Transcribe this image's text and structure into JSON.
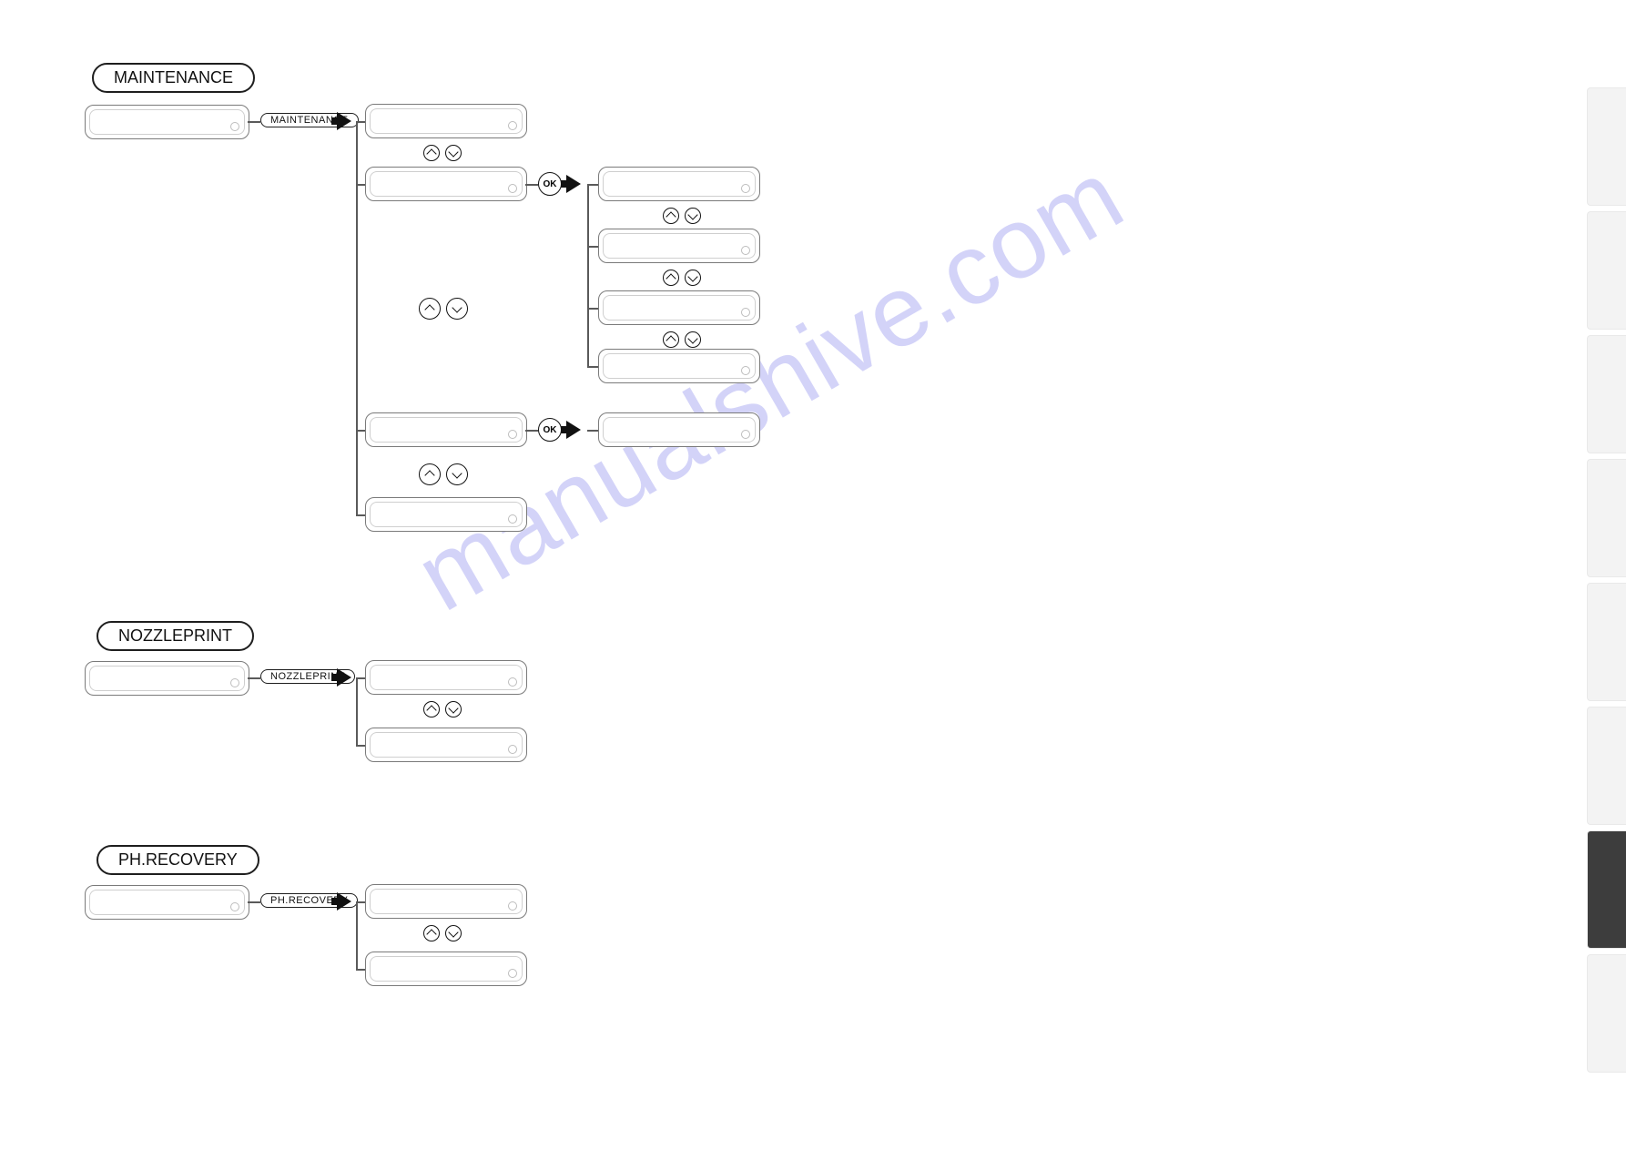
{
  "watermark": "manualshive.com",
  "sections": {
    "maintenance": {
      "heading": "MAINTENANCE",
      "capsule": "MAINTENANCE"
    },
    "nozzleprint": {
      "heading": "NOZZLEPRINT",
      "capsule": "NOZZLEPRINT"
    },
    "phrecovery": {
      "heading": "PH.RECOVERY",
      "capsule": "PH.RECOVERY"
    }
  },
  "buttons": {
    "ok": "OK"
  }
}
